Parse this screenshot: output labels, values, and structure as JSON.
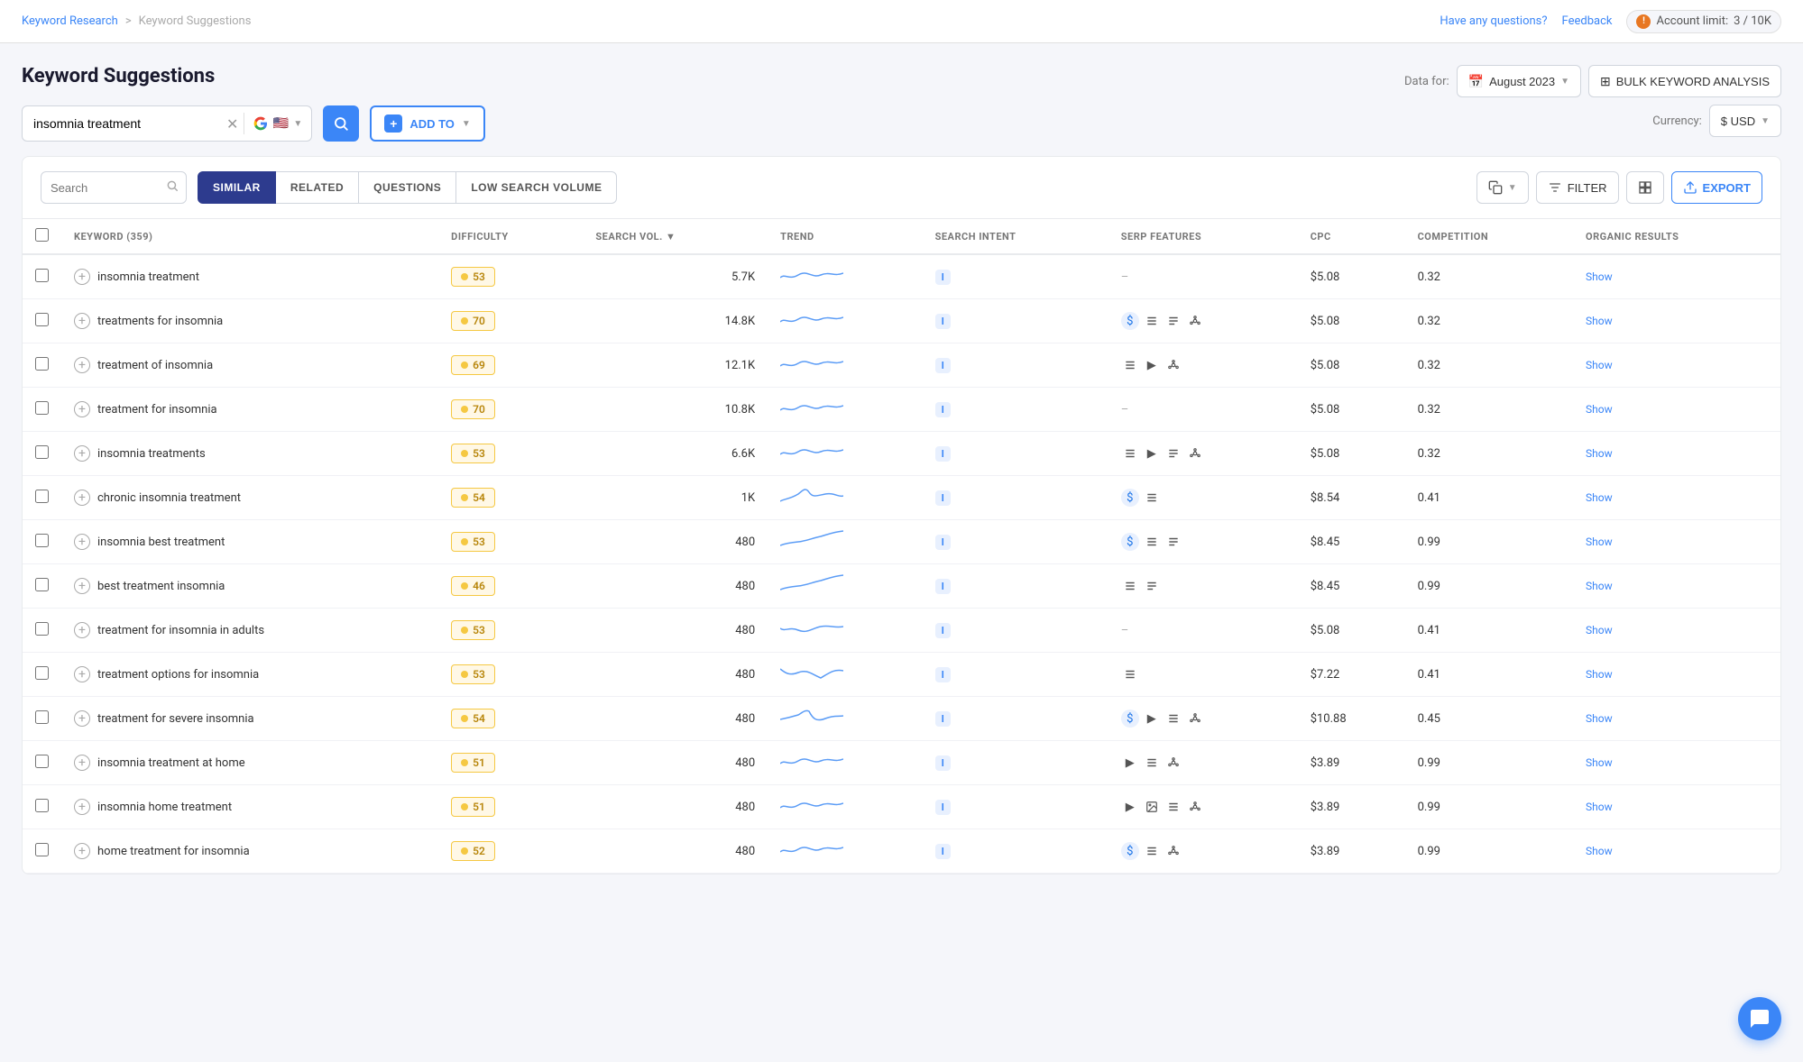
{
  "nav": {
    "breadcrumb_1": "Keyword Research",
    "breadcrumb_sep": ">",
    "breadcrumb_2": "Keyword Suggestions",
    "help_link": "Have any questions?",
    "feedback": "Feedback",
    "account_limit_label": "Account limit:",
    "account_limit_value": "3 / 10K"
  },
  "page": {
    "title": "Keyword Suggestions"
  },
  "search_bar": {
    "input_value": "insomnia treatment",
    "add_to_label": "ADD TO"
  },
  "data_for": {
    "label": "Data for:",
    "date": "August 2023",
    "bulk_btn": "BULK KEYWORD ANALYSIS",
    "currency_label": "Currency:",
    "currency": "$ USD"
  },
  "filter_row": {
    "search_placeholder": "Search",
    "tabs": [
      {
        "label": "SIMILAR",
        "active": true
      },
      {
        "label": "RELATED",
        "active": false
      },
      {
        "label": "QUESTIONS",
        "active": false
      },
      {
        "label": "LOW SEARCH VOLUME",
        "active": false
      }
    ],
    "filter_btn": "FILTER",
    "export_btn": "EXPORT"
  },
  "table": {
    "columns": [
      {
        "key": "keyword",
        "label": "KEYWORD (359)"
      },
      {
        "key": "difficulty",
        "label": "DIFFICULTY"
      },
      {
        "key": "search_vol",
        "label": "SEARCH VOL."
      },
      {
        "key": "trend",
        "label": "TREND"
      },
      {
        "key": "search_intent",
        "label": "SEARCH INTENT"
      },
      {
        "key": "serp_features",
        "label": "SERP FEATURES"
      },
      {
        "key": "cpc",
        "label": "CPC"
      },
      {
        "key": "competition",
        "label": "COMPETITION"
      },
      {
        "key": "organic_results",
        "label": "ORGANIC RESULTS"
      }
    ],
    "rows": [
      {
        "keyword": "insomnia treatment",
        "difficulty": 53,
        "diff_color": "yellow",
        "search_vol": "5.7K",
        "intent": "I",
        "serp_features": [],
        "cpc": "$5.08",
        "competition": "0.32",
        "organic_results": "Show",
        "trend": "mild_wave"
      },
      {
        "keyword": "treatments for insomnia",
        "difficulty": 70,
        "diff_color": "yellow",
        "search_vol": "14.8K",
        "intent": "I",
        "serp_features": [
          "dollar",
          "list",
          "list2",
          "hub"
        ],
        "cpc": "$5.08",
        "competition": "0.32",
        "organic_results": "Show",
        "trend": "mild_wave"
      },
      {
        "keyword": "treatment of insomnia",
        "difficulty": 69,
        "diff_color": "yellow",
        "search_vol": "12.1K",
        "intent": "I",
        "serp_features": [
          "list",
          "video",
          "hub"
        ],
        "cpc": "$5.08",
        "competition": "0.32",
        "organic_results": "Show",
        "trend": "mild_wave"
      },
      {
        "keyword": "treatment for insomnia",
        "difficulty": 70,
        "diff_color": "yellow",
        "search_vol": "10.8K",
        "intent": "I",
        "serp_features": [],
        "cpc": "$5.08",
        "competition": "0.32",
        "organic_results": "Show",
        "trend": "mild_wave"
      },
      {
        "keyword": "insomnia treatments",
        "difficulty": 53,
        "diff_color": "yellow",
        "search_vol": "6.6K",
        "intent": "I",
        "serp_features": [
          "list",
          "video",
          "list2",
          "hub"
        ],
        "cpc": "$5.08",
        "competition": "0.32",
        "organic_results": "Show",
        "trend": "mild_wave"
      },
      {
        "keyword": "chronic insomnia treatment",
        "difficulty": 54,
        "diff_color": "yellow",
        "search_vol": "1K",
        "intent": "I",
        "serp_features": [
          "dollar",
          "list"
        ],
        "cpc": "$8.54",
        "competition": "0.41",
        "organic_results": "Show",
        "trend": "spike_wave"
      },
      {
        "keyword": "insomnia best treatment",
        "difficulty": 53,
        "diff_color": "yellow",
        "search_vol": "480",
        "intent": "I",
        "serp_features": [
          "dollar",
          "list",
          "list2"
        ],
        "cpc": "$8.45",
        "competition": "0.99",
        "organic_results": "Show",
        "trend": "up_wave"
      },
      {
        "keyword": "best treatment insomnia",
        "difficulty": 46,
        "diff_color": "yellow",
        "search_vol": "480",
        "intent": "I",
        "serp_features": [
          "list",
          "list2"
        ],
        "cpc": "$8.45",
        "competition": "0.99",
        "organic_results": "Show",
        "trend": "up_wave"
      },
      {
        "keyword": "treatment for insomnia in adults",
        "difficulty": 53,
        "diff_color": "yellow",
        "search_vol": "480",
        "intent": "I",
        "serp_features": [],
        "cpc": "$5.08",
        "competition": "0.41",
        "organic_results": "Show",
        "trend": "mild_wave2"
      },
      {
        "keyword": "treatment options for insomnia",
        "difficulty": 53,
        "diff_color": "yellow",
        "search_vol": "480",
        "intent": "I",
        "serp_features": [
          "list"
        ],
        "cpc": "$7.22",
        "competition": "0.41",
        "organic_results": "Show",
        "trend": "wavy"
      },
      {
        "keyword": "treatment for severe insomnia",
        "difficulty": 54,
        "diff_color": "yellow",
        "search_vol": "480",
        "intent": "I",
        "serp_features": [
          "dollar",
          "video",
          "list",
          "hub"
        ],
        "cpc": "$10.88",
        "competition": "0.45",
        "organic_results": "Show",
        "trend": "spike2"
      },
      {
        "keyword": "insomnia treatment at home",
        "difficulty": 51,
        "diff_color": "yellow",
        "search_vol": "480",
        "intent": "I",
        "serp_features": [
          "video",
          "list",
          "hub"
        ],
        "cpc": "$3.89",
        "competition": "0.99",
        "organic_results": "Show",
        "trend": "mild_wave"
      },
      {
        "keyword": "insomnia home treatment",
        "difficulty": 51,
        "diff_color": "yellow",
        "search_vol": "480",
        "intent": "I",
        "serp_features": [
          "video",
          "image",
          "list",
          "hub"
        ],
        "cpc": "$3.89",
        "competition": "0.99",
        "organic_results": "Show",
        "trend": "mild_wave"
      },
      {
        "keyword": "home treatment for insomnia",
        "difficulty": 52,
        "diff_color": "yellow",
        "search_vol": "480",
        "intent": "I",
        "serp_features": [
          "dollar",
          "list",
          "hub"
        ],
        "cpc": "$3.89",
        "competition": "0.99",
        "organic_results": "Show",
        "trend": "mild_wave"
      }
    ]
  },
  "chat": {
    "icon": "💬"
  }
}
